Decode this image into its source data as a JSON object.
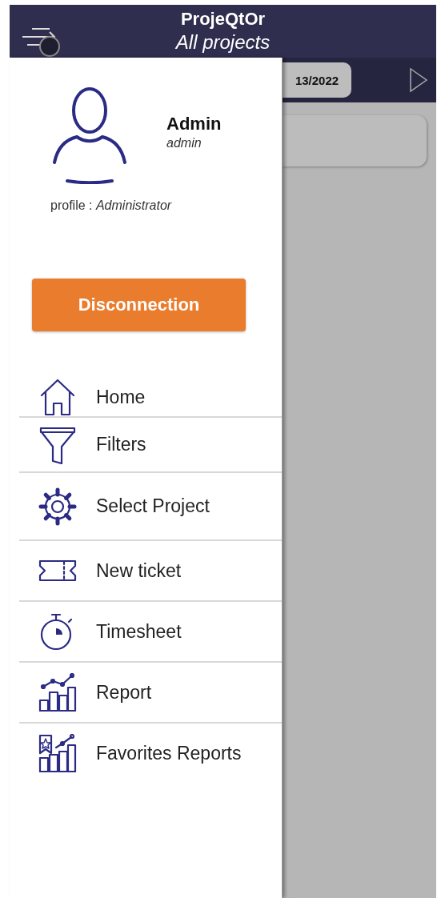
{
  "header": {
    "title": "ProjeQtOr",
    "subtitle": "All projects"
  },
  "toolbar": {
    "date": "13/2022"
  },
  "user": {
    "name": "Admin",
    "login": "admin",
    "profile_label": "profile : ",
    "profile": "Administrator"
  },
  "disconnect_button": "Disconnection",
  "menu": [
    {
      "kind": "home",
      "label": "Home"
    },
    {
      "kind": "filter",
      "label": "Filters"
    },
    {
      "kind": "settings",
      "label": "Select Project"
    },
    {
      "kind": "ticket",
      "label": "New ticket"
    },
    {
      "kind": "timer",
      "label": "Timesheet"
    },
    {
      "kind": "report",
      "label": "Report"
    },
    {
      "kind": "favorite-report",
      "label": "Favorites Reports"
    }
  ]
}
